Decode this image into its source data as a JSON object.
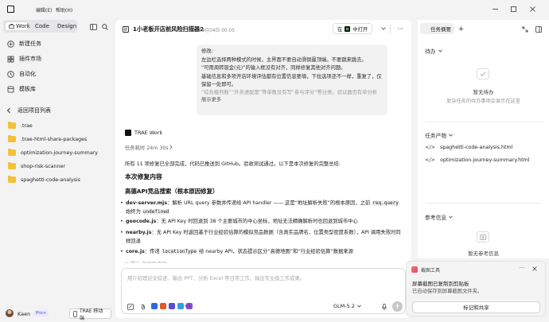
{
  "menu": {
    "edit": "编辑(E)",
    "help": "帮助(H)"
  },
  "sidebar": {
    "tabs": [
      {
        "label": "Work",
        "active": true
      },
      {
        "label": "Code",
        "active": false
      },
      {
        "label": "Design",
        "active": false
      }
    ],
    "nav": [
      {
        "label": "新建任务",
        "icon": "new-task-icon"
      },
      {
        "label": "插件市场",
        "icon": "plugin-market-icon"
      },
      {
        "label": "自动化",
        "icon": "automation-icon"
      },
      {
        "label": "模板库",
        "icon": "template-icon"
      }
    ],
    "projects_title": "返回项目列表",
    "projects": [
      ".trae",
      ".trae-html-share-packages",
      "optimization-journey-summary",
      "shop-risk-scanner",
      "spaghetti-code-analysis"
    ],
    "user": {
      "name": "Kaen",
      "badge": "Pro+",
      "mobile_button": "TRAE 移动端"
    }
  },
  "header": {
    "title": "1小老板开店前风险扫描器2",
    "date": "08月04日 00:05",
    "open_in_prefix": "在",
    "open_in_label": "中打开"
  },
  "user_message": {
    "lines": [
      "修改:",
      "左边栏选择两种模式的时候，主界面不要自动滑倒最顶端。不要跳来跳去。",
      "“可用周转现金(元)”的输入框没有对齐，同样修复其他对齐问题。",
      "基础信息和多项开店环境评估都有位置信息要填，下拉选项还不一样，重复了，仅保留一处即可。",
      "“综合楼判断”“外卖进配度”等单数没有写“参与评分”等分类，验证器否有单分析"
    ],
    "show_more": "展示更多"
  },
  "assistant": {
    "name": "TRAE Work",
    "duration": "任务耗时 24m 30s",
    "intro": "所有 11 项修复已全部完成，代码已推送到 GitHub。验收测试通过。以下是本次修复的完整总结:",
    "section_title": "本次修复内容",
    "subsection_title": "高德API竞品搜索（根本原因修复）",
    "bullets": [
      {
        "file": "dev-server.mjs",
        "text_a": "：解析 URL query 参数并传递给 API handler —— 这是“地址解析失败”的根本原因，之前 ",
        "code_a": "req.query",
        "text_b": " 始终为 ",
        "code_b": "undefined"
      },
      {
        "file": "geocode.js",
        "text_a": "：无 API Key 时回退到 38 个主要城市的中心坐标，地址无法精确解析时也回退到城市中心"
      },
      {
        "file": "nearby.js",
        "text_a": "：无 API Key 时返回基于行业经验估算的模拟竞品数据（含真实品牌名、位置类型密度系数），API 调用失败时同样回退"
      },
      {
        "file": "core.js",
        "text_a": "：传递 ",
        "code_a": "locationType",
        "text_b": " 给 nearby API，状态提示区分“高德地图”和“行业经验估算”数据来源"
      }
    ],
    "truncated": "▽ 提示 的修复内容 ..."
  },
  "input": {
    "placeholder": "用介绍理论文综述、输出 PPT、分析 Excel 等日常工作、输出专业级工作成果。",
    "more_count": "+5",
    "model": "GLM-5.2"
  },
  "right_panel": {
    "tab_label": "任务摘要",
    "pending_title": "待办",
    "pending_empty_title": "暂无待办",
    "pending_empty_sub": "复杂任务的待办事项会显示在这里",
    "outputs_title": "任务产物",
    "outputs": [
      "spaghetti-code-analysis.html",
      "optimization-journey-summary.html"
    ],
    "refs_title": "参考信息",
    "refs_empty_title": "暂无参考信息"
  },
  "toast": {
    "title": "截图工具",
    "line1": "屏幕截图已复制到剪贴板",
    "line2": "已自动保存到屏幕截图文件夹。",
    "button": "标记和共享"
  },
  "colors": {
    "accent": "#1f1f1f",
    "send_button": "#c7c7c9",
    "folder": "#f2c23c",
    "pro_badge": "#4a4fe0"
  }
}
